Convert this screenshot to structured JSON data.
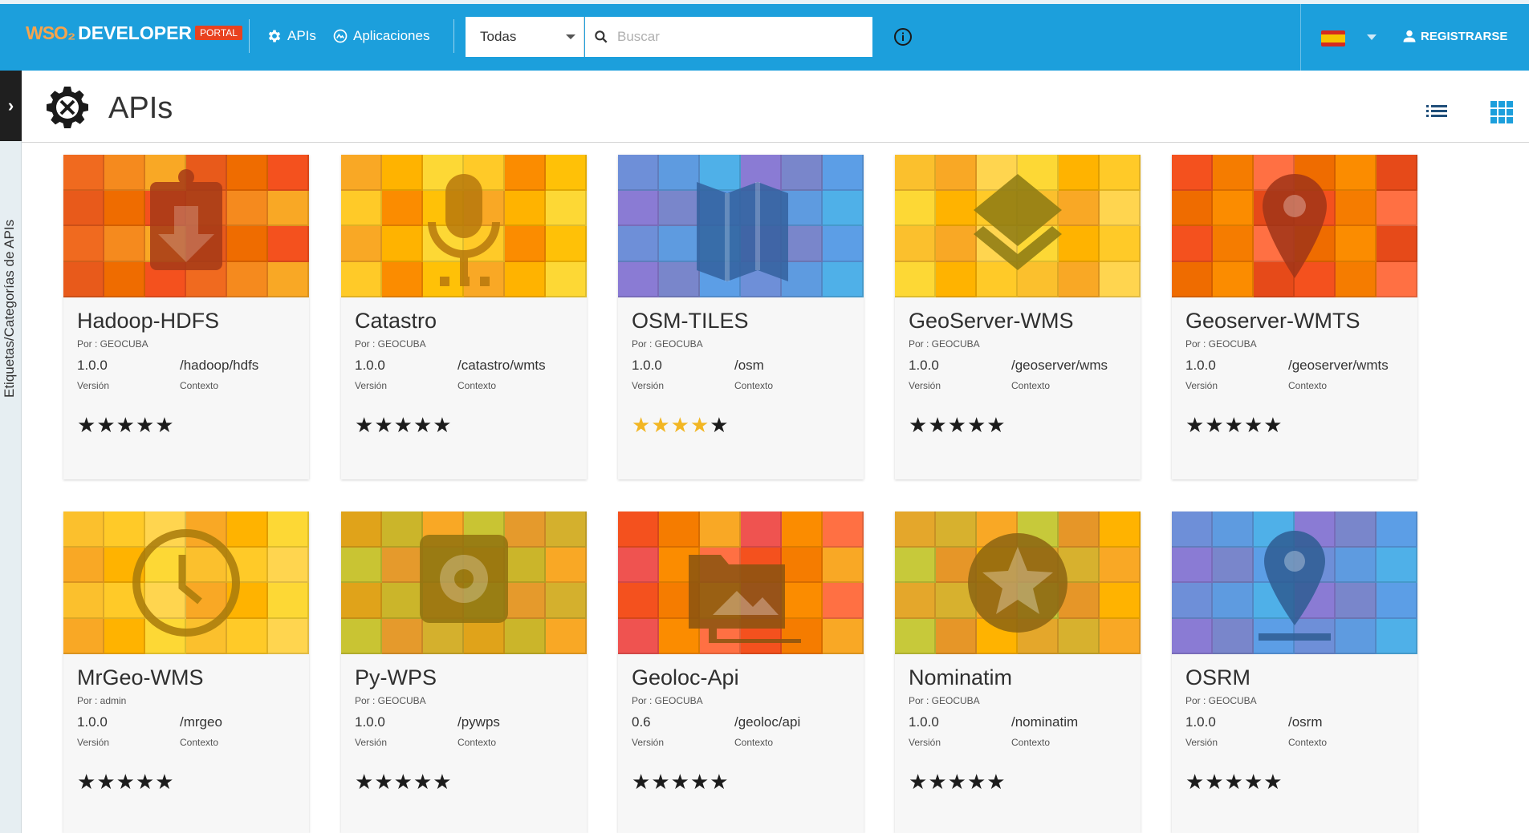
{
  "header": {
    "brand_wso2": "WSO₂",
    "brand_developer": "DEVELOPER",
    "brand_portal": "PORTAL",
    "nav": [
      {
        "label": "APIs",
        "icon": "gear-icon"
      },
      {
        "label": "Aplicaciones",
        "icon": "apps-icon"
      }
    ],
    "filter_selected": "Todas",
    "search_placeholder": "Buscar",
    "register_label": "REGISTRARSE"
  },
  "sidebar": {
    "vertical_label": "Etiquetas/Categorías de APIs"
  },
  "page": {
    "title": "APIs"
  },
  "labels": {
    "version": "Versión",
    "context": "Contexto"
  },
  "colors": {
    "topbar": "#1c9fdc",
    "portal_badge": "#e8421f",
    "star_gold": "#f2b623"
  },
  "apis": [
    {
      "name": "Hadoop-HDFS",
      "by": "Por : GEOCUBA",
      "version": "1.0.0",
      "context": "/hadoop/hdfs",
      "rating": 0,
      "icon": "download-icon"
    },
    {
      "name": "Catastro",
      "by": "Por : GEOCUBA",
      "version": "1.0.0",
      "context": "/catastro/wmts",
      "rating": 0,
      "icon": "microphone-icon"
    },
    {
      "name": "OSM-TILES",
      "by": "Por : GEOCUBA",
      "version": "1.0.0",
      "context": "/osm",
      "rating": 4,
      "icon": "map-icon"
    },
    {
      "name": "GeoServer-WMS",
      "by": "Por : GEOCUBA",
      "version": "1.0.0",
      "context": "/geoserver/wms",
      "rating": 0,
      "icon": "layers-icon"
    },
    {
      "name": "Geoserver-WMTS",
      "by": "Por : GEOCUBA",
      "version": "1.0.0",
      "context": "/geoserver/wmts",
      "rating": 0,
      "icon": "location-pin-icon"
    },
    {
      "name": "MrGeo-WMS",
      "by": "Por : admin",
      "version": "1.0.0",
      "context": "/mrgeo",
      "rating": 0,
      "icon": "clock-icon"
    },
    {
      "name": "Py-WPS",
      "by": "Por : GEOCUBA",
      "version": "1.0.0",
      "context": "/pywps",
      "rating": 0,
      "icon": "settings-icon"
    },
    {
      "name": "Geoloc-Api",
      "by": "Por : GEOCUBA",
      "version": "0.6",
      "context": "/geoloc/api",
      "rating": 0,
      "icon": "photo-folder-icon"
    },
    {
      "name": "Nominatim",
      "by": "Por : GEOCUBA",
      "version": "1.0.0",
      "context": "/nominatim",
      "rating": 0,
      "icon": "star-circle-icon"
    },
    {
      "name": "OSRM",
      "by": "Por : GEOCUBA",
      "version": "1.0.0",
      "context": "/osrm",
      "rating": 0,
      "icon": "pin-drop-icon"
    }
  ]
}
